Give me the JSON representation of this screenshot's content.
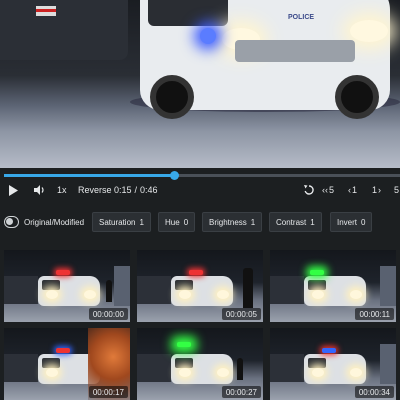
{
  "player": {
    "speed": "1x",
    "reverse_label": "Reverse",
    "current_time": "0:15",
    "separator": "/",
    "duration": "0:46",
    "progress_fraction": 0.43,
    "accent_color": "#38a8e8",
    "video_text": "POLICE",
    "skip_back_large": "5",
    "skip_back_small": "1",
    "skip_fwd_small": "1",
    "skip_fwd_large": "5"
  },
  "filters": {
    "toggle_label": "Original/Modified",
    "chips": [
      {
        "label": "Saturation",
        "value": "1"
      },
      {
        "label": "Hue",
        "value": "0"
      },
      {
        "label": "Brightness",
        "value": "1"
      },
      {
        "label": "Contrast",
        "value": "1"
      },
      {
        "label": "Invert",
        "value": "0"
      }
    ]
  },
  "thumbnails": [
    {
      "timestamp": "00:00:00",
      "siren_color": "#e33"
    },
    {
      "timestamp": "00:00:05",
      "siren_color": "#e33"
    },
    {
      "timestamp": "00:00:11",
      "siren_color": "#3f4"
    },
    {
      "timestamp": "00:00:17",
      "siren_color": "#36f"
    },
    {
      "timestamp": "00:00:27",
      "siren_color": "#3f4"
    },
    {
      "timestamp": "00:00:34",
      "siren_color": "#36f"
    }
  ]
}
